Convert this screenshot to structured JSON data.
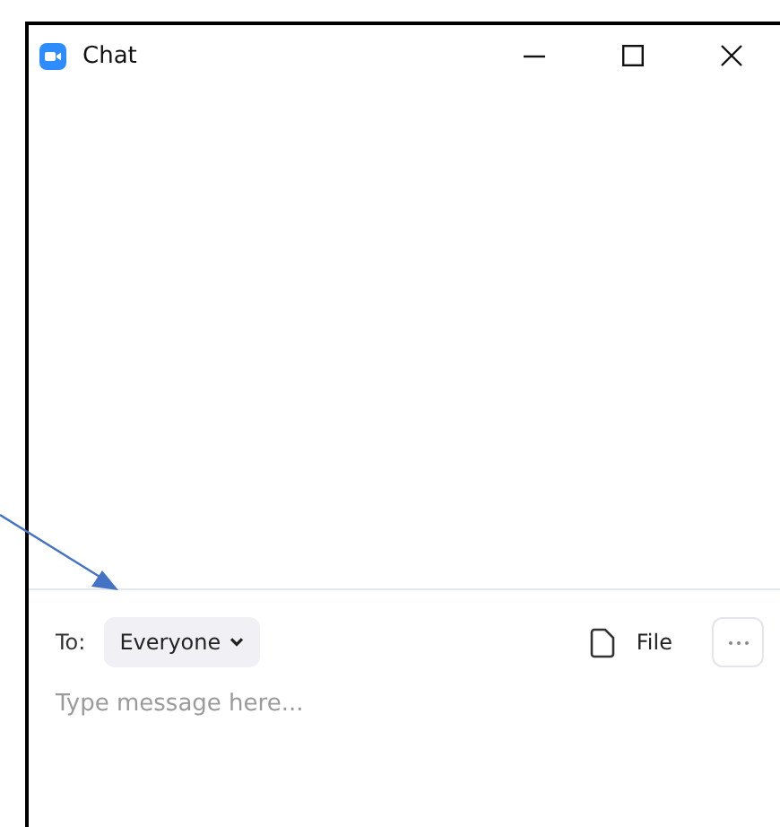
{
  "window": {
    "title": "Chat"
  },
  "recipient": {
    "label": "To:",
    "value": "Everyone"
  },
  "file_button": {
    "label": "File"
  },
  "message_field": {
    "placeholder": "Type message here..."
  }
}
